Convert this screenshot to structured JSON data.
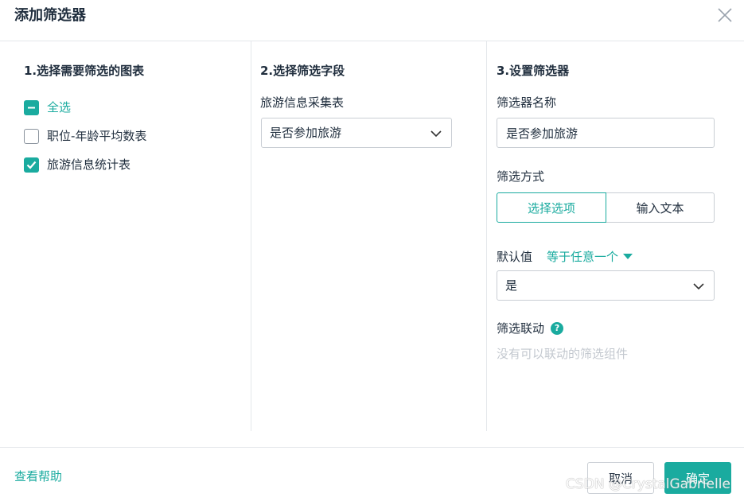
{
  "dialog": {
    "title": "添加筛选器",
    "close_icon": "close-icon"
  },
  "step1": {
    "heading": "1.选择需要筛选的图表",
    "select_all": {
      "label": "全选",
      "state": "indeterminate"
    },
    "charts": [
      {
        "label": "职位-年龄平均数表",
        "checked": false
      },
      {
        "label": "旅游信息统计表",
        "checked": true
      }
    ]
  },
  "step2": {
    "heading": "2.选择筛选字段",
    "table_label": "旅游信息采集表",
    "field_value": "是否参加旅游"
  },
  "step3": {
    "heading": "3.设置筛选器",
    "name_label": "筛选器名称",
    "name_value": "是否参加旅游",
    "mode_label": "筛选方式",
    "mode_options": [
      "选择选项",
      "输入文本"
    ],
    "mode_selected": "选择选项",
    "default_label": "默认值",
    "default_mode": "等于任意一个",
    "default_value": "是",
    "link_label": "筛选联动",
    "link_help_icon": "?",
    "link_empty": "没有可以联动的筛选组件"
  },
  "footer": {
    "help": "查看帮助",
    "cancel": "取消",
    "confirm": "确定"
  },
  "watermark": "CSDN @CrystalGabrielle",
  "colors": {
    "accent": "#1aab9f",
    "text": "#1f2d3d",
    "border": "#c9ced4",
    "muted": "#c3c8cf"
  }
}
